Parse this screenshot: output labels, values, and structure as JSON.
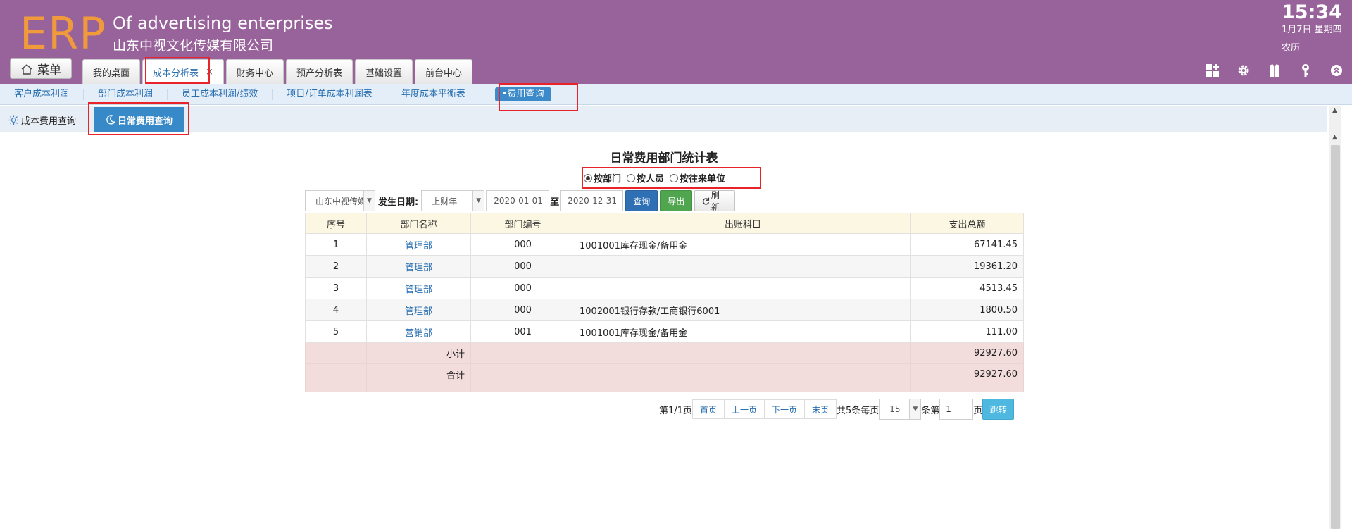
{
  "header": {
    "logo": "ERP",
    "company_en": "Of advertising enterprises",
    "company_cn": "山东中视文化传媒有限公司",
    "time": "15:34",
    "date": "1月7日 星期四",
    "lunar": "农历",
    "menu_label": "菜单",
    "tabs": [
      {
        "label": "我的桌面"
      },
      {
        "label": "成本分析表",
        "close": "×"
      },
      {
        "label": "财务中心"
      },
      {
        "label": "预产分析表"
      },
      {
        "label": "基础设置"
      },
      {
        "label": "前台中心"
      }
    ],
    "toolbar_icons": [
      "grid-add-icon",
      "gear-icon",
      "shirt-icon",
      "key-icon",
      "chevron-up-circle-icon"
    ]
  },
  "sub_nav": {
    "items": [
      "客户成本利润",
      "部门成本利润",
      "员工成本利润/绩效",
      "项目/订单成本利润表",
      "年度成本平衡表"
    ],
    "active": "•费用查询"
  },
  "inner_tabs": {
    "plain": "成本费用查询",
    "active": "日常费用查询"
  },
  "report": {
    "title": "日常费用部门统计表",
    "modes": [
      {
        "label": "按部门",
        "checked": true
      },
      {
        "label": "按人员",
        "checked": false
      },
      {
        "label": "按往来单位",
        "checked": false
      }
    ],
    "filter": {
      "company_value": "山东中视传媒",
      "date_label": "发生日期:",
      "period_value": "上财年",
      "start_date": "2020-01-01",
      "to_label": "至",
      "end_date": "2020-12-31",
      "query_btn": "查询",
      "export_btn": "导出",
      "refresh_btn": "刷新"
    },
    "columns": [
      "序号",
      "部门名称",
      "部门编号",
      "出账科目",
      "支出总额"
    ],
    "rows": [
      {
        "no": "1",
        "dept": "管理部",
        "code": "000",
        "account": "1001001库存现金/备用金",
        "amount": "67141.45"
      },
      {
        "no": "2",
        "dept": "管理部",
        "code": "000",
        "account": "",
        "amount": "19361.20"
      },
      {
        "no": "3",
        "dept": "管理部",
        "code": "000",
        "account": "",
        "amount": "4513.45"
      },
      {
        "no": "4",
        "dept": "管理部",
        "code": "000",
        "account": "1002001银行存款/工商银行6001",
        "amount": "1800.50"
      },
      {
        "no": "5",
        "dept": "营销部",
        "code": "001",
        "account": "1001001库存现金/备用金",
        "amount": "111.00"
      }
    ],
    "subtotal_label": "小计",
    "subtotal_value": "92927.60",
    "total_label": "合计",
    "total_value": "92927.60"
  },
  "pager": {
    "page_info": "第1/1页",
    "first": "首页",
    "prev": "上一页",
    "next": "下一页",
    "last": "末页",
    "total_text": "共5条每页",
    "page_size": "15",
    "goto_prefix": "条第",
    "page_input": "1",
    "page_suffix": "页",
    "go_btn": "跳转"
  },
  "colors": {
    "header_bg": "#98629b",
    "logo": "#f09a3c",
    "accent_blue": "#3789c8",
    "link": "#2a6fb0",
    "summary_bg": "#f2dcdc",
    "highlight": "#e8232a"
  }
}
